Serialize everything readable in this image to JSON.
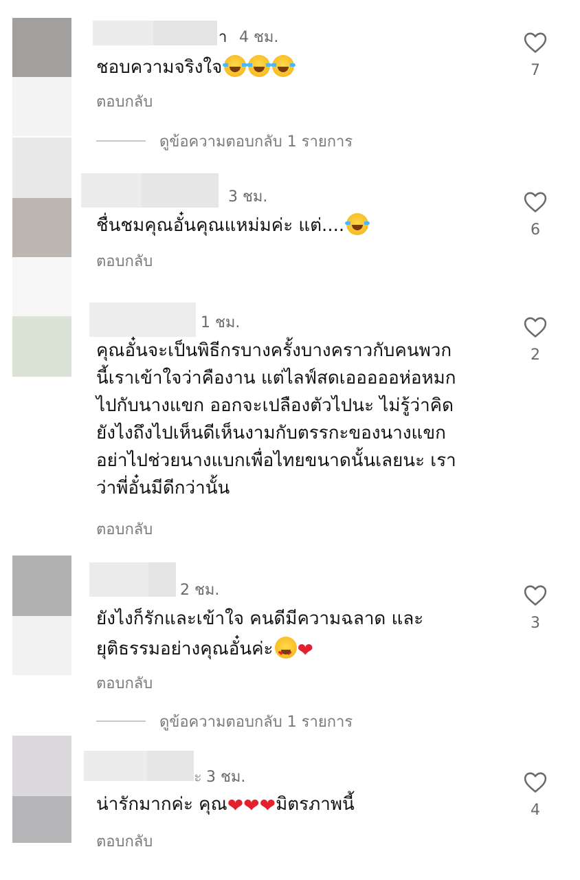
{
  "common": {
    "reply_label": "ตอบกลับ",
    "view_replies_label": "ดูข้อความตอบกลับ 1 รายการ"
  },
  "comments": [
    {
      "time": "4 ชม.",
      "text": "ชอบความจริงใจ",
      "emojis": [
        "laughing-face",
        "laughing-face",
        "laughing-face"
      ],
      "likes": "7",
      "username_fragment": "า"
    },
    {
      "time": "3 ชม.",
      "text": "ชื่นชมคุณอั๋นคุณแหม่มค่ะ แต่....",
      "emojis": [
        "laughing-face"
      ],
      "likes": "6"
    },
    {
      "time": "1 ชม.",
      "lines": [
        "คุณอั๋นจะเป็นพิธีกรบางครั้งบางคราวกับคนพวก",
        "นี้เราเข้าใจว่าคืองาน แต่ไลฟ์สดเอออออห่อหมก",
        "ไปกับนางแขก ออกจะเปลืองตัวไปนะ ไม่รู้ว่าคิด",
        "ยังไงถึงไปเห็นดีเห็นงามกับตรรกะของนางแขก",
        "อย่าไปช่วยนางแบกเพื่อไทยขนาดนั้นเลยนะ เรา",
        "ว่าพี่อั๋นมีดีกว่านั้น"
      ],
      "likes": "2"
    },
    {
      "time": "2 ชม.",
      "line1": "ยังไงก็รักและเข้าใจ คนดีมีความฉลาด และ",
      "line2": "ยุติธรรมอย่างคุณอั๋นค่ะ",
      "emojis": [
        "heart-eyes-face",
        "red-heart"
      ],
      "likes": "3"
    },
    {
      "time": "3 ชม.",
      "text_before": "น่ารักมากค่ะ คุณ",
      "text_after": "มิตรภาพนี้",
      "emojis": [
        "red-heart",
        "red-heart",
        "red-heart"
      ],
      "likes": "4",
      "username_fragment": "ะ"
    }
  ],
  "colors": {
    "text": "#121212",
    "meta": "#6a6a6a",
    "reply": "#7a7a7a",
    "heart_outline": "#6a6a6a",
    "red_heart": "#e5202e"
  }
}
